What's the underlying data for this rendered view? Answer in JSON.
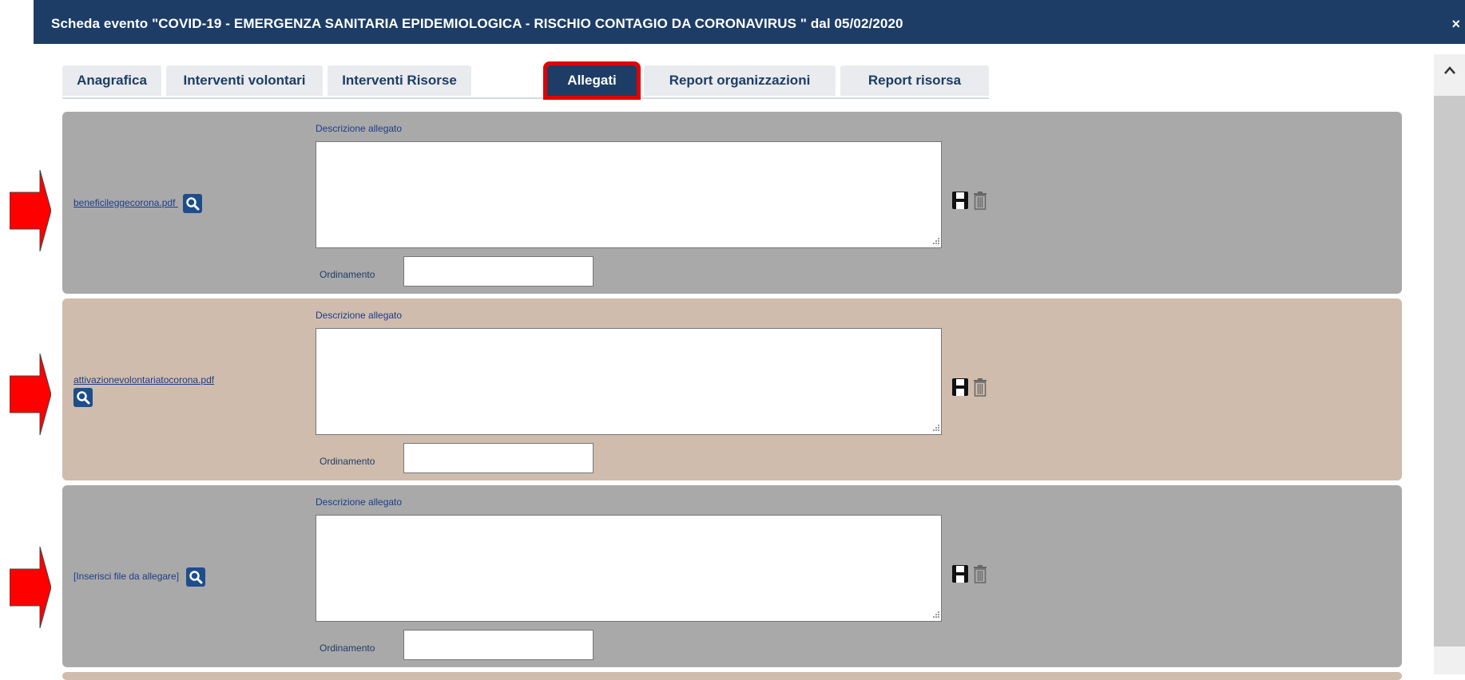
{
  "window": {
    "title": "Scheda evento \"COVID-19 - EMERGENZA SANITARIA EPIDEMIOLOGICA - RISCHIO CONTAGIO DA CORONAVIRUS \" dal 05/02/2020",
    "close_label": "×"
  },
  "tabs": [
    {
      "label": "Anagrafica"
    },
    {
      "label": "Interventi volontari"
    },
    {
      "label": "Interventi Risorse"
    },
    {
      "label": "Allegati",
      "active": true
    },
    {
      "label": "Report organizzazioni"
    },
    {
      "label": "Report risorsa"
    }
  ],
  "attachments": [
    {
      "file_label": "beneficileggecorona.pdf",
      "description_label": "Descrizione allegato",
      "description_value": "",
      "order_label": "Ordinamento",
      "order_value": "",
      "background": "#a9a9a9"
    },
    {
      "file_label": "attivazionevolontariatocorona.pdf",
      "description_label": "Descrizione allegato",
      "description_value": "",
      "order_label": "Ordinamento",
      "order_value": "",
      "background": "#cfbcac"
    },
    {
      "file_label": "[Inserisci file da allegare]",
      "description_label": "Descrizione allegato",
      "description_value": "",
      "order_label": "Ordinamento",
      "order_value": "",
      "background": "#a9a9a9"
    }
  ],
  "icons": {
    "search": "search-icon",
    "save": "save-icon",
    "delete": "trash-icon",
    "callout": "red-arrow-icon",
    "scroll_up": "chevron-up-icon"
  },
  "colors": {
    "title_bar": "#1d3d66",
    "highlight": "#e00000",
    "link": "#1d3d8a"
  }
}
